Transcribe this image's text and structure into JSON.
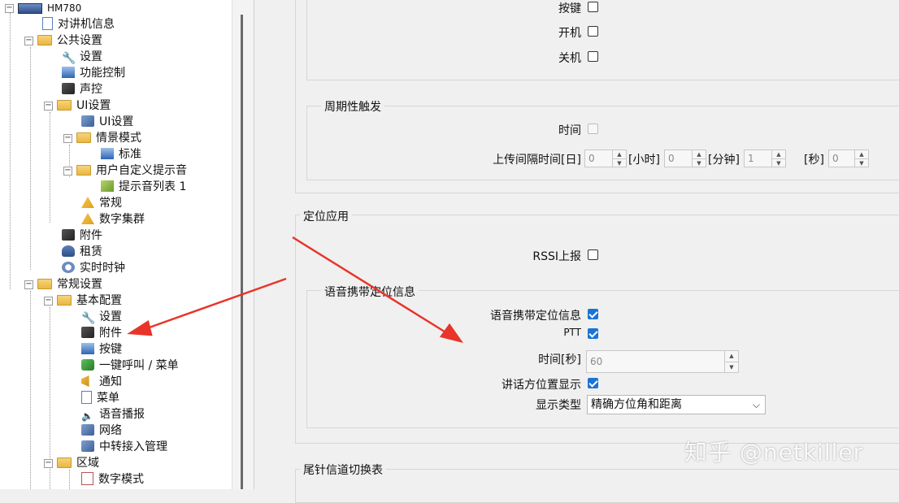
{
  "tree": {
    "items": [
      {
        "label": "HM780"
      },
      {
        "label": "对讲机信息"
      },
      {
        "label": "公共设置"
      },
      {
        "label": "设置"
      },
      {
        "label": "功能控制"
      },
      {
        "label": "声控"
      },
      {
        "label": "UI设置"
      },
      {
        "label": "UI设置"
      },
      {
        "label": "情景模式"
      },
      {
        "label": "标准"
      },
      {
        "label": "用户自定义提示音"
      },
      {
        "label": "提示音列表 1"
      },
      {
        "label": "常规"
      },
      {
        "label": "数字集群"
      },
      {
        "label": "附件"
      },
      {
        "label": "租赁"
      },
      {
        "label": "实时时钟"
      },
      {
        "label": "常规设置"
      },
      {
        "label": "基本配置"
      },
      {
        "label": "设置"
      },
      {
        "label": "附件"
      },
      {
        "label": "按键"
      },
      {
        "label": "一键呼叫 / 菜单"
      },
      {
        "label": "通知"
      },
      {
        "label": "菜单"
      },
      {
        "label": "语音播报"
      },
      {
        "label": "网络"
      },
      {
        "label": "中转接入管理"
      },
      {
        "label": "区域"
      },
      {
        "label": "数字模式"
      }
    ]
  },
  "triggers": {
    "key_label": "按键",
    "poweron_label": "开机",
    "poweroff_label": "关机"
  },
  "periodic": {
    "title": "周期性触发",
    "time_label": "时间",
    "interval_label": "上传间隔时间[日]",
    "days_value": "0",
    "hours_label": "[小时]",
    "hours_value": "0",
    "minutes_label": "[分钟]",
    "minutes_value": "1",
    "seconds_label": "[秒]",
    "seconds_value": "0"
  },
  "location": {
    "title": "定位应用",
    "rssi_label": "RSSI上报"
  },
  "voice_location": {
    "title": "语音携带定位信息",
    "carry_label": "语音携带定位信息",
    "carry_checked": true,
    "ptt_label": "PTT",
    "ptt_checked": true,
    "time_label": "时间[秒]",
    "time_value": "60",
    "speaker_label": "讲话方位置显示",
    "speaker_checked": true,
    "display_type_label": "显示类型",
    "display_type_value": "精确方位角和距离"
  },
  "tail": {
    "title": "尾针信道切换表"
  },
  "watermark": "知乎 @netkiller",
  "colors": {
    "checkbox_checked": "#1a73d6",
    "arrow": "#e8342a"
  }
}
